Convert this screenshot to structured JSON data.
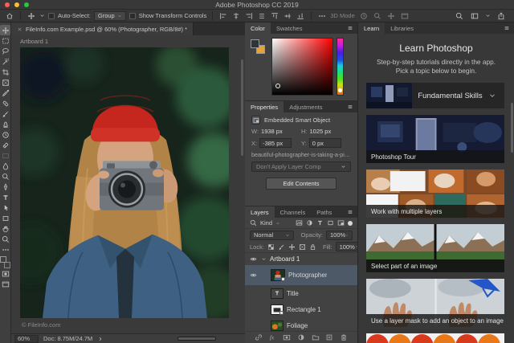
{
  "titlebar": {
    "title": "Adobe Photoshop CC 2019"
  },
  "options_bar": {
    "auto_select_label": "Auto-Select:",
    "auto_select_value": "Group",
    "show_transform_label": "Show Transform Controls",
    "mode_3d_label": "3D Mode"
  },
  "toolbar": {
    "tools": [
      "move",
      "marquee",
      "lasso",
      "quick-selection",
      "crop",
      "frame",
      "eyedropper",
      "healing-brush",
      "brush",
      "clone-stamp",
      "history-brush",
      "eraser",
      "gradient",
      "blur",
      "dodge",
      "pen",
      "type",
      "path-selection",
      "rectangle",
      "hand",
      "zoom",
      "more-tools",
      "quick-mask",
      "screen-mode"
    ],
    "foreground_color": "#2f343a",
    "background_color": "#e3a43b"
  },
  "document": {
    "tab_title": "FileInfo.com Example.psd @ 60% (Photographer, RGB/8#) *",
    "artboard_label": "Artboard 1",
    "watermark": "© FileInfo.com",
    "zoom_level": "60%",
    "doc_size": "Doc: 8.75M/24.7M"
  },
  "color_panel": {
    "tabs": [
      "Color",
      "Swatches"
    ]
  },
  "properties_panel": {
    "tabs": [
      "Properties",
      "Adjustments"
    ],
    "object_type": "Embedded Smart Object",
    "w_label": "W:",
    "w_value": "1938 px",
    "h_label": "H:",
    "h_value": "1025 px",
    "x_label": "X:",
    "x_value": "-385 px",
    "y_label": "Y:",
    "y_value": "0 px",
    "source_file": "beautiful-photographer-is-taking-a-pict...",
    "layer_comp": "Don't Apply Layer Comp",
    "edit_button": "Edit Contents"
  },
  "layers_panel": {
    "tabs": [
      "Layers",
      "Channels",
      "Paths"
    ],
    "filter_label": "Kind",
    "blend_mode": "Normal",
    "opacity_label": "Opacity:",
    "opacity_value": "100%",
    "lock_label": "Lock:",
    "fill_label": "Fill:",
    "fill_value": "100%",
    "layers": [
      {
        "name": "Artboard 1"
      },
      {
        "name": "Photographer"
      },
      {
        "name": "Title"
      },
      {
        "name": "Rectangle 1"
      },
      {
        "name": "Foliage"
      }
    ]
  },
  "learn_panel": {
    "tabs": [
      "Learn",
      "Libraries"
    ],
    "heading": "Learn Photoshop",
    "subtitle": "Step-by-step tutorials directly in the app. Pick a topic below to begin.",
    "section_label": "Fundamental Skills",
    "cards": [
      {
        "title": "Photoshop Tour"
      },
      {
        "title": "Work with multiple layers"
      },
      {
        "title": "Select part of an image"
      },
      {
        "title": "Use a layer mask to add an object to an image"
      }
    ]
  }
}
